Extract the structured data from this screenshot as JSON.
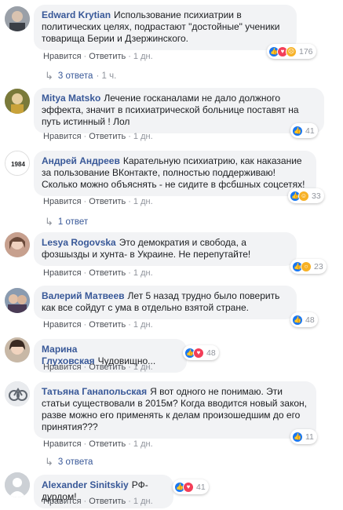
{
  "comments": [
    {
      "author": "Edward Krytian",
      "text": "Использование психиатрии в политических целях, подрастают \"достойные\" ученики товарища Берии и Дзержинского.",
      "like": "Нравится",
      "reply": "Ответить",
      "time": "1 дн.",
      "reactions": [
        "like-icon",
        "love-icon",
        "sad-icon"
      ],
      "count": "176",
      "replies": "3 ответа",
      "replies_time": "1 ч."
    },
    {
      "author": "Mitya Matsko",
      "text": "Лечение госканалами не дало должного эффекта, значит в психиатрической больнице поставят на путь истинный ! Лол",
      "like": "Нравится",
      "reply": "Ответить",
      "time": "1 дн.",
      "reactions": [
        "like-icon"
      ],
      "count": "41"
    },
    {
      "author": "Андрей Андреев",
      "avatar_text": "1984",
      "text": "Карательную психиатрию, как наказание за пользование ВКонтакте, полностью поддерживаю! Сколько можно объяснять - не сидите в фсбшных соцсетях!",
      "like": "Нравится",
      "reply": "Ответить",
      "time": "1 дн.",
      "reactions": [
        "like-icon",
        "haha-icon"
      ],
      "count": "33",
      "replies": "1 ответ"
    },
    {
      "author": "Lesya Rogovska",
      "text": "Это демократия и свобода, а фозшызды и хунта- в Украине. Не перепутайте!",
      "like": "Нравится",
      "reply": "Ответить",
      "time": "1 дн.",
      "reactions": [
        "like-icon",
        "wow-icon"
      ],
      "count": "23"
    },
    {
      "author": "Валерий Матвеев",
      "text": "Лет 5 назад трудно было поверить как все сойдут с ума в отдельно взятой стране.",
      "like": "Нравится",
      "reply": "Ответить",
      "time": "1 дн.",
      "reactions": [
        "like-icon"
      ],
      "count": "48"
    },
    {
      "author": "Марина Глуховская",
      "text": "Чудовищно...",
      "like": "Нравится",
      "reply": "Ответить",
      "time": "1 дн.",
      "reactions": [
        "like-icon",
        "love-icon"
      ],
      "count": "48"
    },
    {
      "author": "Татьяна Ганапольская",
      "text": "Я вот одного не понимаю. Эти статьи существовали в 2015м? Когда вводится новый закон, разве можно его применять к делам произошедшим до его принятия???",
      "like": "Нравится",
      "reply": "Ответить",
      "time": "1 дн.",
      "reactions": [
        "like-icon"
      ],
      "count": "11",
      "replies": "3 ответа"
    },
    {
      "author": "Alexander Sinitskiy",
      "text": "РФ-дурдом!",
      "like": "Нравится",
      "reply": "Ответить",
      "time": "1 дн.",
      "reactions": [
        "like-icon",
        "love-icon"
      ],
      "count": "41"
    }
  ],
  "colors": {
    "author": "#385898",
    "bubble": "#f2f3f5",
    "meta": "#90949c",
    "like": "#1877f2",
    "love": "#f33e58",
    "emoji": "#f7b125"
  }
}
